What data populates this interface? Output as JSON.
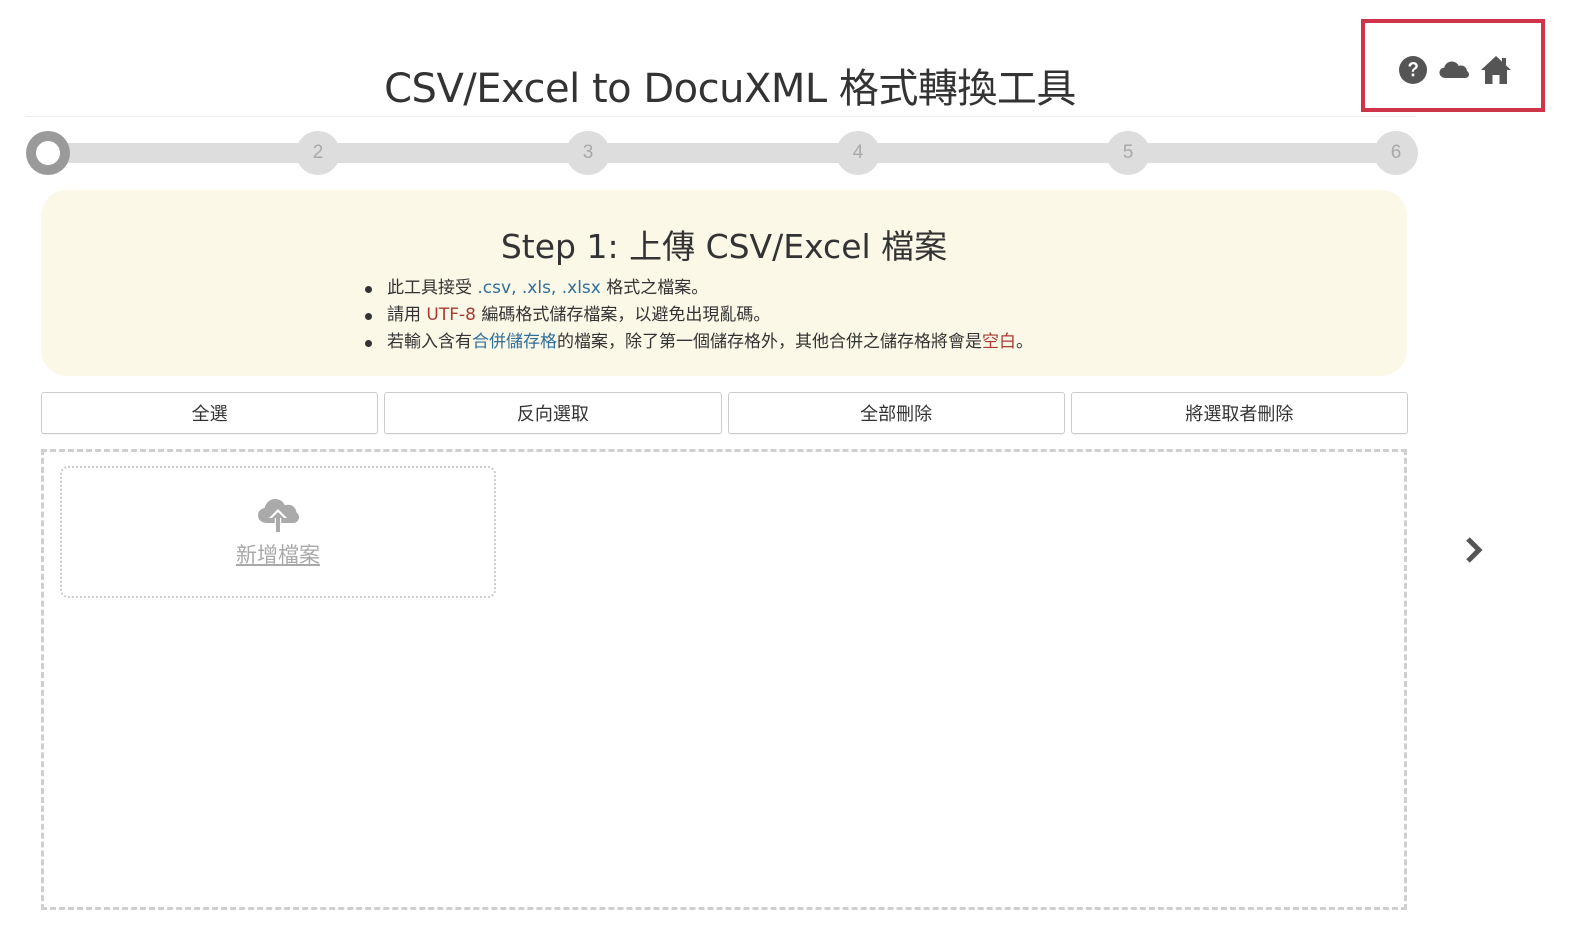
{
  "header": {
    "title": "CSV/Excel to DocuXML 格式轉換工具",
    "icons": [
      "question-circle-icon",
      "cloud-icon",
      "home-icon"
    ]
  },
  "stepper": {
    "steps": [
      "",
      "2",
      "3",
      "4",
      "5",
      "6"
    ],
    "active_step": 1
  },
  "info": {
    "title": "Step 1: 上傳 CSV/Excel 檔案",
    "line1": {
      "pre": "此工具接受 ",
      "hl": ".csv, .xls, .xlsx",
      "post": " 格式之檔案。"
    },
    "line2": {
      "pre": "請用 ",
      "hl": "UTF-8",
      "post": " 編碼格式儲存檔案，以避免出現亂碼。"
    },
    "line3": {
      "pre": "若輸入含有",
      "hl1": "合併儲存格",
      "mid": "的檔案，除了第一個儲存格外，其他合併之儲存格將會是",
      "hl2": "空白",
      "post": "。"
    }
  },
  "actions": {
    "select_all": "全選",
    "invert_selection": "反向選取",
    "delete_all": "全部刪除",
    "delete_selected": "將選取者刪除"
  },
  "dropzone": {
    "add_file_label": "新增檔案"
  },
  "colors": {
    "highlight_border": "#d0344a",
    "info_bg": "#fcf8e7",
    "link_blue": "#2f6f9c",
    "emphasis_red": "#a83a34"
  }
}
